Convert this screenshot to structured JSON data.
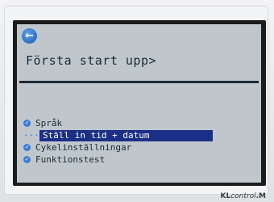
{
  "screen": {
    "title": "Första start upp>",
    "back_icon": "back-arrow-icon"
  },
  "menu": {
    "items": [
      {
        "label": "Språk",
        "selected": false
      },
      {
        "label": "Ställ in tid + datum",
        "selected": true
      },
      {
        "label": "Cykelinställningar",
        "selected": false
      },
      {
        "label": "Funktionstest",
        "selected": false
      }
    ]
  },
  "brand": {
    "prefix": "KL",
    "middle": "control",
    "suffix": ".M"
  },
  "colors": {
    "lcd_background": "#bfc7cd",
    "selection": "#1c2f86",
    "accent": "#3a7bd5"
  }
}
